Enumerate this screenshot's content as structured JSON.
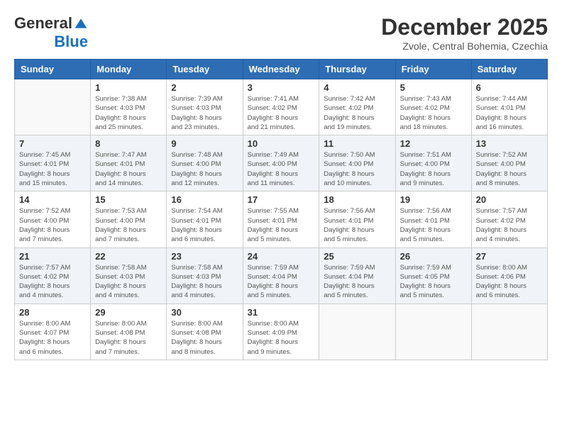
{
  "header": {
    "logo_line1": "General",
    "logo_line2": "Blue",
    "month_title": "December 2025",
    "location": "Zvole, Central Bohemia, Czechia"
  },
  "weekdays": [
    "Sunday",
    "Monday",
    "Tuesday",
    "Wednesday",
    "Thursday",
    "Friday",
    "Saturday"
  ],
  "weeks": [
    [
      {
        "day": "",
        "info": ""
      },
      {
        "day": "1",
        "info": "Sunrise: 7:38 AM\nSunset: 4:03 PM\nDaylight: 8 hours\nand 25 minutes."
      },
      {
        "day": "2",
        "info": "Sunrise: 7:39 AM\nSunset: 4:03 PM\nDaylight: 8 hours\nand 23 minutes."
      },
      {
        "day": "3",
        "info": "Sunrise: 7:41 AM\nSunset: 4:02 PM\nDaylight: 8 hours\nand 21 minutes."
      },
      {
        "day": "4",
        "info": "Sunrise: 7:42 AM\nSunset: 4:02 PM\nDaylight: 8 hours\nand 19 minutes."
      },
      {
        "day": "5",
        "info": "Sunrise: 7:43 AM\nSunset: 4:02 PM\nDaylight: 8 hours\nand 18 minutes."
      },
      {
        "day": "6",
        "info": "Sunrise: 7:44 AM\nSunset: 4:01 PM\nDaylight: 8 hours\nand 16 minutes."
      }
    ],
    [
      {
        "day": "7",
        "info": "Sunrise: 7:45 AM\nSunset: 4:01 PM\nDaylight: 8 hours\nand 15 minutes."
      },
      {
        "day": "8",
        "info": "Sunrise: 7:47 AM\nSunset: 4:01 PM\nDaylight: 8 hours\nand 14 minutes."
      },
      {
        "day": "9",
        "info": "Sunrise: 7:48 AM\nSunset: 4:00 PM\nDaylight: 8 hours\nand 12 minutes."
      },
      {
        "day": "10",
        "info": "Sunrise: 7:49 AM\nSunset: 4:00 PM\nDaylight: 8 hours\nand 11 minutes."
      },
      {
        "day": "11",
        "info": "Sunrise: 7:50 AM\nSunset: 4:00 PM\nDaylight: 8 hours\nand 10 minutes."
      },
      {
        "day": "12",
        "info": "Sunrise: 7:51 AM\nSunset: 4:00 PM\nDaylight: 8 hours\nand 9 minutes."
      },
      {
        "day": "13",
        "info": "Sunrise: 7:52 AM\nSunset: 4:00 PM\nDaylight: 8 hours\nand 8 minutes."
      }
    ],
    [
      {
        "day": "14",
        "info": "Sunrise: 7:52 AM\nSunset: 4:00 PM\nDaylight: 8 hours\nand 7 minutes."
      },
      {
        "day": "15",
        "info": "Sunrise: 7:53 AM\nSunset: 4:00 PM\nDaylight: 8 hours\nand 7 minutes."
      },
      {
        "day": "16",
        "info": "Sunrise: 7:54 AM\nSunset: 4:01 PM\nDaylight: 8 hours\nand 6 minutes."
      },
      {
        "day": "17",
        "info": "Sunrise: 7:55 AM\nSunset: 4:01 PM\nDaylight: 8 hours\nand 5 minutes."
      },
      {
        "day": "18",
        "info": "Sunrise: 7:56 AM\nSunset: 4:01 PM\nDaylight: 8 hours\nand 5 minutes."
      },
      {
        "day": "19",
        "info": "Sunrise: 7:56 AM\nSunset: 4:01 PM\nDaylight: 8 hours\nand 5 minutes."
      },
      {
        "day": "20",
        "info": "Sunrise: 7:57 AM\nSunset: 4:02 PM\nDaylight: 8 hours\nand 4 minutes."
      }
    ],
    [
      {
        "day": "21",
        "info": "Sunrise: 7:57 AM\nSunset: 4:02 PM\nDaylight: 8 hours\nand 4 minutes."
      },
      {
        "day": "22",
        "info": "Sunrise: 7:58 AM\nSunset: 4:03 PM\nDaylight: 8 hours\nand 4 minutes."
      },
      {
        "day": "23",
        "info": "Sunrise: 7:58 AM\nSunset: 4:03 PM\nDaylight: 8 hours\nand 4 minutes."
      },
      {
        "day": "24",
        "info": "Sunrise: 7:59 AM\nSunset: 4:04 PM\nDaylight: 8 hours\nand 5 minutes."
      },
      {
        "day": "25",
        "info": "Sunrise: 7:59 AM\nSunset: 4:04 PM\nDaylight: 8 hours\nand 5 minutes."
      },
      {
        "day": "26",
        "info": "Sunrise: 7:59 AM\nSunset: 4:05 PM\nDaylight: 8 hours\nand 5 minutes."
      },
      {
        "day": "27",
        "info": "Sunrise: 8:00 AM\nSunset: 4:06 PM\nDaylight: 8 hours\nand 6 minutes."
      }
    ],
    [
      {
        "day": "28",
        "info": "Sunrise: 8:00 AM\nSunset: 4:07 PM\nDaylight: 8 hours\nand 6 minutes."
      },
      {
        "day": "29",
        "info": "Sunrise: 8:00 AM\nSunset: 4:08 PM\nDaylight: 8 hours\nand 7 minutes."
      },
      {
        "day": "30",
        "info": "Sunrise: 8:00 AM\nSunset: 4:08 PM\nDaylight: 8 hours\nand 8 minutes."
      },
      {
        "day": "31",
        "info": "Sunrise: 8:00 AM\nSunset: 4:09 PM\nDaylight: 8 hours\nand 9 minutes."
      },
      {
        "day": "",
        "info": ""
      },
      {
        "day": "",
        "info": ""
      },
      {
        "day": "",
        "info": ""
      }
    ]
  ]
}
